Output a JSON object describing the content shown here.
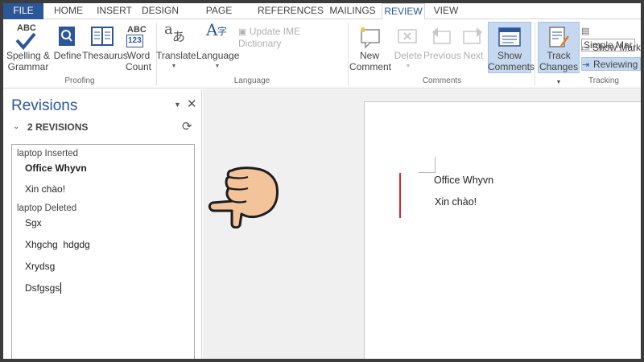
{
  "tabs": [
    "FILE",
    "HOME",
    "INSERT",
    "DESIGN",
    "PAGE LAYOUT",
    "REFERENCES",
    "MAILINGS",
    "REVIEW",
    "VIEW"
  ],
  "active_tab": "REVIEW",
  "proofing": {
    "spelling": {
      "icon_text": "ABC",
      "l1": "Spelling &",
      "l2": "Grammar"
    },
    "define": "Define",
    "thesaurus": "Thesaurus",
    "word_count": {
      "icon_text1": "ABC",
      "icon_text2": "123",
      "l1": "Word",
      "l2": "Count"
    },
    "group_label": "Proofing"
  },
  "language": {
    "translate": "Translate",
    "language": "Language",
    "ime": "Update IME Dictionary",
    "group_label": "Language"
  },
  "comments": {
    "new": {
      "l1": "New",
      "l2": "Comment"
    },
    "delete": "Delete",
    "previous": "Previous",
    "next": "Next",
    "show": {
      "l1": "Show",
      "l2": "Comments"
    },
    "group_label": "Comments"
  },
  "tracking": {
    "track": {
      "l1": "Track",
      "l2": "Changes"
    },
    "display_mode": "Simple Mar",
    "show_markup": "Show Marku",
    "reviewing_pane": "Reviewing P",
    "group_label": "Tracking"
  },
  "revisions_pane": {
    "title": "Revisions",
    "count_label": "2 REVISIONS",
    "groups": [
      {
        "header": "laptop Inserted",
        "items": [
          "Office Whyvn",
          "Xin chào!"
        ]
      },
      {
        "header": "laptop Deleted",
        "items": [
          "Sgx",
          "Xhgchg  hdgdg",
          "Xrydsg",
          "Dsfgsgs"
        ]
      }
    ]
  },
  "document": {
    "lines": [
      "Office Whyvn",
      "Xin chào!"
    ]
  },
  "colors": {
    "accent": "#2b579a",
    "change_bar": "#e0222b"
  }
}
